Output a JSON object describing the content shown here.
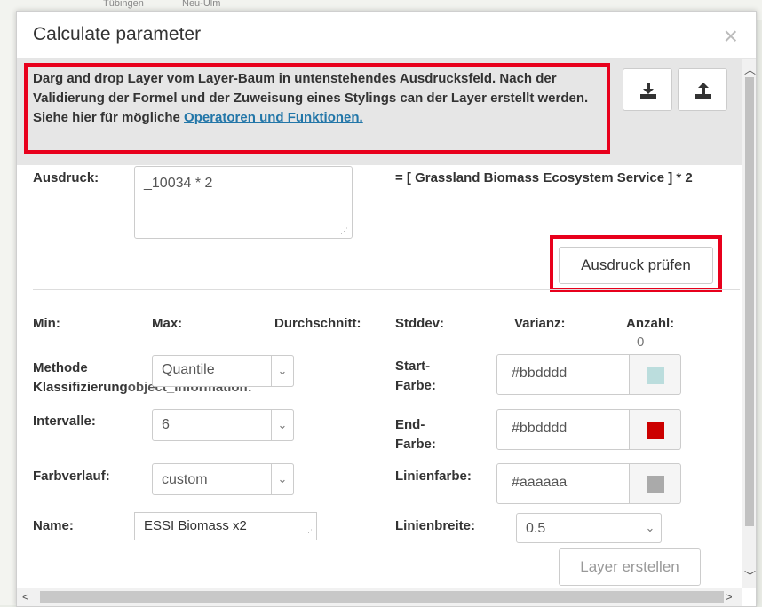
{
  "map": {
    "label_a": "Tübingen",
    "label_b": "Neu-Ulm"
  },
  "dialog": {
    "title": "Calculate parameter",
    "close_label": "×"
  },
  "info": {
    "text": "Darg and drop Layer vom Layer-Baum in untenstehendes Ausdrucksfeld. Nach der Validierung der Formel und der Zuweisung eines Stylings can der Layer erstellt werden. Siehe hier für mögliche ",
    "link": "Operatoren und Funktionen."
  },
  "expression": {
    "label": "Ausdruck:",
    "value": "_10034 * 2",
    "result": "= [ Grassland Biomass Ecosystem Service ] * 2",
    "check_button": "Ausdruck prüfen"
  },
  "stats": {
    "min_label": "Min:",
    "max_label": "Max:",
    "avg_label": "Durchschnitt:",
    "stddev_label": "Stddev:",
    "variance_label": "Varianz:",
    "count_label": "Anzahl:",
    "count_value": "0"
  },
  "form": {
    "method_label_1": "Methode",
    "method_label_2": "Klassifizierung",
    "method_overlap": "object_information:",
    "method_value": "Quantile",
    "intervals_label": "Intervalle:",
    "intervals_value": "6",
    "gradient_label": "Farbverlauf:",
    "gradient_value": "custom",
    "name_label": "Name:",
    "name_value": "ESSI Biomass x2",
    "start_color_label_1": "Start-",
    "start_color_label_2": "Farbe:",
    "start_color_value": "#bbdddd",
    "start_color_swatch": "#bbdddd",
    "end_color_label_1": "End-",
    "end_color_label_2": "Farbe:",
    "end_color_value": "#bbdddd",
    "end_color_swatch": "#cc0000",
    "line_color_label": "Linienfarbe:",
    "line_color_value": "#aaaaaa",
    "line_color_swatch": "#aaaaaa",
    "line_width_label": "Linienbreite:",
    "line_width_value": "0.5",
    "create_button": "Layer erstellen"
  },
  "icons": [
    "download-icon",
    "upload-icon",
    "close-icon",
    "chevron-down-icon",
    "scroll-up-icon",
    "scroll-down-icon",
    "scroll-left-icon",
    "scroll-right-icon"
  ],
  "colors": {
    "highlight": "#e8001c",
    "link": "#2276a8"
  }
}
